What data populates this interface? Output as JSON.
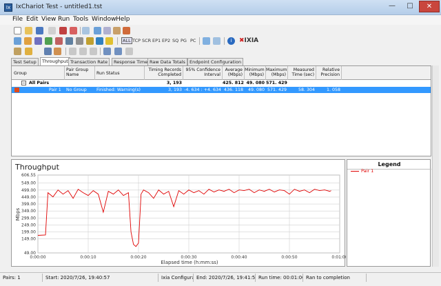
{
  "window": {
    "title": "IxChariot Test - untitled1.tst"
  },
  "menu": [
    "File",
    "Edit",
    "View",
    "Run",
    "Tools",
    "Window",
    "Help"
  ],
  "toolbar": {
    "all_label": "ALL",
    "protocol_labels": [
      "TCP",
      "SCR",
      "EP1",
      "EP2",
      "SQ",
      "PG",
      "PC"
    ],
    "brand": "IXIA"
  },
  "tabs": [
    "Test Setup",
    "Throughput",
    "Transaction Rate",
    "Response Time",
    "Raw Data Totals",
    "Endpoint Configuration"
  ],
  "grid": {
    "headers": [
      "Group",
      "Pair Group Name",
      "Run Status",
      "Timing Records Completed",
      "95% Confidence Interval",
      "Average (Mbps)",
      "Minimum (Mbps)",
      "Maximum (Mbps)",
      "Measured Time (sec)",
      "Relative Precision"
    ],
    "all_pairs": {
      "group": "All Pairs",
      "records": "3, 193",
      "average": "425. 812",
      "minimum": "49. 080",
      "maximum": "571. 429"
    },
    "pair": {
      "group": "Pair 1",
      "pair_group": "No Group",
      "status": "Finished: Warning(s)",
      "records": "3, 193",
      "confidence": "-4. 634 : +4. 634",
      "average": "436. 118",
      "minimum": "49. 080",
      "maximum": "571. 429",
      "measured": "58. 304",
      "precision": "1. 058"
    }
  },
  "chart_data": {
    "type": "line",
    "title": "Throughput",
    "xlabel": "Elapsed time (h:mm:ss)",
    "ylabel": "Mbps",
    "ylim": [
      49.0,
      606.55
    ],
    "yticks": [
      "606.55",
      "549.00",
      "499.00",
      "449.00",
      "399.00",
      "349.00",
      "299.00",
      "249.00",
      "199.00",
      "149.00",
      "49.00"
    ],
    "ytick_values": [
      606.55,
      549,
      499,
      449,
      399,
      349,
      299,
      249,
      199,
      149,
      49
    ],
    "xticks": [
      "0:00:00",
      "0:00:10",
      "0:00:20",
      "0:00:30",
      "0:00:40",
      "0:00:50",
      "0:01:00"
    ],
    "xlim": [
      0,
      60
    ],
    "series": [
      {
        "name": "Pair 1",
        "color": "#e00000",
        "x": [
          0,
          1.5,
          2,
          3,
          4,
          5,
          6,
          7,
          8,
          9,
          10,
          11,
          12,
          13,
          14,
          15,
          16,
          17,
          18,
          18.5,
          19,
          19.5,
          20,
          20.5,
          21,
          22,
          23,
          24,
          25,
          26,
          27,
          28,
          29,
          30,
          31,
          32,
          33,
          34,
          35,
          36,
          37,
          38,
          39,
          40,
          41,
          42,
          43,
          44,
          45,
          46,
          47,
          48,
          49,
          50,
          51,
          52,
          53,
          54,
          55,
          56,
          57,
          58,
          58.3
        ],
        "values": [
          175,
          178,
          480,
          450,
          500,
          470,
          495,
          440,
          505,
          480,
          460,
          495,
          470,
          340,
          490,
          470,
          500,
          460,
          480,
          200,
          110,
          95,
          120,
          470,
          500,
          480,
          440,
          500,
          470,
          490,
          380,
          495,
          470,
          500,
          480,
          495,
          470,
          505,
          485,
          500,
          490,
          505,
          480,
          500,
          495,
          505,
          480,
          500,
          490,
          505,
          485,
          500,
          495,
          470,
          505,
          490,
          500,
          480,
          505,
          495,
          500,
          490,
          495
        ]
      }
    ]
  },
  "legend": {
    "title": "Legend",
    "items": [
      "Pair 1"
    ]
  },
  "status": {
    "pairs": "Pairs: 1",
    "start": "Start: 2020/7/26, 19:40:57",
    "config": "Ixia Configuratio",
    "end": "End: 2020/7/26, 19:41:57",
    "runtime": "Run time: 00:01:00",
    "completion": "Ran to completion"
  }
}
